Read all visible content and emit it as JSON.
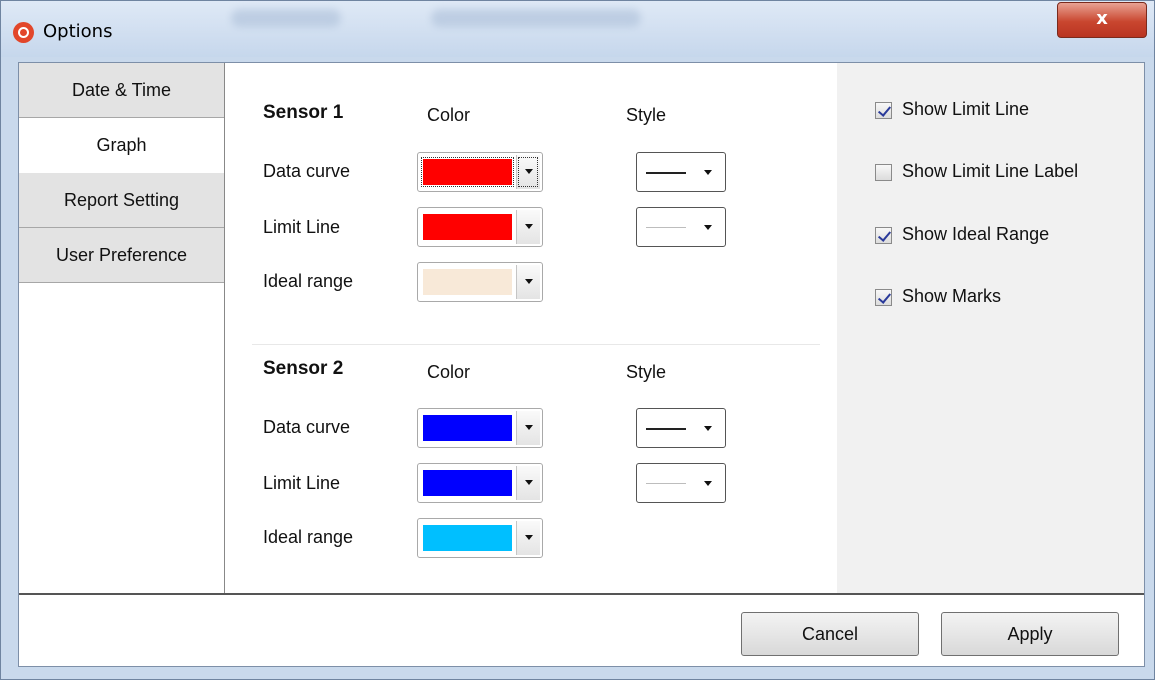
{
  "window": {
    "title": "Options",
    "close_glyph": "x"
  },
  "tabs": [
    {
      "label": "Date & Time",
      "active": false
    },
    {
      "label": "Graph",
      "active": true
    },
    {
      "label": "Report Setting",
      "active": false
    },
    {
      "label": "User Preference",
      "active": false
    }
  ],
  "sensors": [
    {
      "title": "Sensor 1",
      "color_header": "Color",
      "style_header": "Style",
      "rows": [
        {
          "label": "Data curve",
          "color": "#ff0000",
          "style": "solid"
        },
        {
          "label": "Limit Line",
          "color": "#ff0000",
          "style": "thin"
        },
        {
          "label": "Ideal range",
          "color": "#f8e9d8"
        }
      ]
    },
    {
      "title": "Sensor 2",
      "color_header": "Color",
      "style_header": "Style",
      "rows": [
        {
          "label": "Data curve",
          "color": "#0000ff",
          "style": "solid"
        },
        {
          "label": "Limit Line",
          "color": "#0000ff",
          "style": "thin"
        },
        {
          "label": "Ideal range",
          "color": "#00bfff"
        }
      ]
    }
  ],
  "options": [
    {
      "label": "Show Limit Line",
      "checked": true
    },
    {
      "label": "Show Limit Line Label",
      "checked": false
    },
    {
      "label": "Show Ideal Range",
      "checked": true
    },
    {
      "label": "Show Marks",
      "checked": true
    }
  ],
  "footer": {
    "cancel_label": "Cancel",
    "apply_label": "Apply"
  }
}
